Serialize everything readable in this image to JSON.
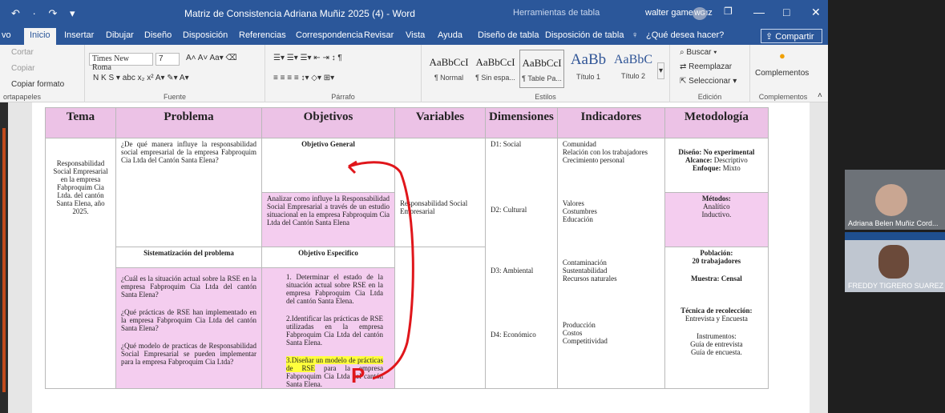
{
  "titlebar": {
    "quick_access": "↶ · ↷ ▾",
    "doc_title": "Matriz de Consistencia Adriana Muñiz 2025 (4)  -  Word",
    "context_title": "Herramientas de tabla",
    "user": "walter game cruz",
    "user_initials": "WG",
    "restore": "❐",
    "min": "—",
    "max": "□",
    "close": "✕"
  },
  "tabs": [
    "Inicio",
    "Insertar",
    "Dibujar",
    "Diseño",
    "Disposición",
    "Referencias",
    "Correspondencia",
    "Revisar",
    "Vista",
    "Ayuda",
    "Diseño de tabla",
    "Disposición de tabla"
  ],
  "tab_prev": "vo",
  "tell_me": "¿Qué desea hacer?",
  "share": "Compartir",
  "ribbon": {
    "clipboard": {
      "cut": "Cortar",
      "copy": "Copiar",
      "format": "Copiar formato",
      "label": "ortapapeles"
    },
    "font": {
      "name": "Times New Roma",
      "size": "7",
      "label": "Fuente",
      "row1": "A˄  A˅  Aa▾  ⌫",
      "row2": "N  K  S ▾  abc  x₂  x²   A▾  ✎▾  A▾"
    },
    "paragraph": {
      "label": "Párrafo",
      "row1": "☰▾  ☰▾  ☰▾   ⇤  ⇥   ↕   ¶",
      "row2": "≡  ≡  ≡  ≡   ↕▾   ◇▾  ⊞▾"
    },
    "styles": {
      "label": "Estilos",
      "items": [
        {
          "sample": "AaBbCcI",
          "name": "¶ Normal"
        },
        {
          "sample": "AaBbCcI",
          "name": "¶ Sin espa..."
        },
        {
          "sample": "AaBbCcI",
          "name": "¶ Table Pa..."
        },
        {
          "sample": "AaBb",
          "name": "Título 1"
        },
        {
          "sample": "AaBbC",
          "name": "Título 2"
        }
      ]
    },
    "editing": {
      "find": "Buscar",
      "replace": "Reemplazar",
      "select": "Seleccionar",
      "label": "Edición"
    },
    "addins": {
      "name": "Complementos",
      "label": "Complementos"
    }
  },
  "table": {
    "headers": [
      "Tema",
      "Problema",
      "Objetivos",
      "Variables",
      "Dimensiones",
      "Indicadores",
      "Metodología"
    ],
    "tema": "Responsabilidad Social Empresarial en la empresa Fabproquim Cia Ltda. del cantón Santa Elena, año 2025.",
    "problema_general": "¿De qué manera influye la responsabilidad social empresarial de la empresa Fabproquim Cia Ltda del Cantón Santa Elena?",
    "sistematizacion_title": "Sistematización del problema",
    "sistematizacion": [
      "¿Cuál es la situación actual sobre la RSE en la empresa Fabproquim Cia Ltda del cantón Santa Elena?",
      "¿Qué prácticas de RSE han implementado en la empresa Fabproquim Cia Ltda del cantón Santa Elena?",
      "¿Qué modelo de practicas de Responsabilidad Social Empresarial se pueden implementar para la empresa Fabproquim Cia Ltda?"
    ],
    "obj_general_title": "Objetivo General",
    "obj_general": "Analizar como influye la Responsabilidad Social Empresarial a través de un estudio situacional en la empresa Fabproquim Cia Ltda del Cantón Santa Elena",
    "obj_especifico_title": "Objetivo Especifico",
    "obj_especificos": [
      "1. Determinar el estado de la situación actual sobre RSE en la empresa Fabproquim Cia Ltda del cantón Santa Elena.",
      "2.Identificar las prácticas de RSE utilizadas en la empresa Fabproquim Cia Ltda del cantón Santa Elena."
    ],
    "obj3_highlight": "3.Diseñar un modelo de prácticas de RSE",
    "obj3_rest": "para la empresa Fabproquim Cia Ltda del cantón Santa Elena.",
    "variable": "Responsabilidad Social Empresarial",
    "dimensiones": [
      "D1: Social",
      "D2: Cultural",
      "D3: Ambiental",
      "D4: Económico"
    ],
    "indicadores": [
      [
        "Comunidad",
        "Relación con los trabajadores",
        "Crecimiento personal"
      ],
      [
        "Valores",
        "Costumbres",
        "Educación"
      ],
      [
        "Contaminación",
        "Sustentabilidad",
        "Recursos naturales"
      ],
      [
        "Producción",
        "Costos",
        "Competitividad"
      ]
    ],
    "metodologia": {
      "diseno_label": "Diseño:",
      "diseno": "No experimental",
      "alcance_label": "Alcance:",
      "alcance": "Descriptivo",
      "enfoque_label": "Enfoque:",
      "enfoque": "Mixto",
      "metodos_label": "Métodos:",
      "metodos": [
        "Analítico",
        "Inductivo."
      ],
      "poblacion_label": "Población:",
      "poblacion": "20 trabajadores",
      "muestra_label": "Muestra:",
      "muestra": "Censal",
      "tecnica_label": "Técnica de recolección:",
      "tecnica": "Entrevista y Encuesta",
      "instrumentos_label": "Instrumentos:",
      "instrumentos": [
        "Guía de entrevista",
        "Guía de encuesta."
      ]
    }
  },
  "participants": [
    {
      "name": "Adriana Belen Muñiz Cord..."
    },
    {
      "name": "FREDDY TIGRERO SUAREZ"
    }
  ],
  "annotation": {
    "letter": "P",
    "color": "#e0161b"
  }
}
